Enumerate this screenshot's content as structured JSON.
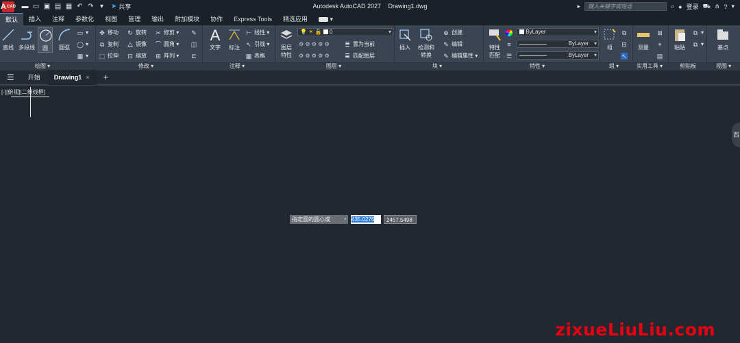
{
  "title_bar": {
    "logo_letter": "A",
    "logo_sub": "CAD",
    "share_label": "共享",
    "app_name": "Autodesk AutoCAD 2027",
    "file_name": "Drawing1.dwg",
    "search_placeholder": "键入关键字或短语",
    "login_label": "登录"
  },
  "ribbon_tabs": [
    "默认",
    "插入",
    "注释",
    "参数化",
    "视图",
    "管理",
    "输出",
    "附加模块",
    "协作",
    "Express Tools",
    "精选应用"
  ],
  "panels": {
    "draw": {
      "label": "绘图 ▾",
      "line": "直线",
      "polyline": "多段线",
      "circle": "圆",
      "arc": "圆弧"
    },
    "modify": {
      "label": "修改 ▾",
      "move": "移动",
      "rotate": "旋转",
      "trim": "修剪",
      "copy": "复制",
      "mirror": "镜像",
      "fillet": "圆角",
      "stretch": "拉伸",
      "scale": "缩放",
      "array": "阵列"
    },
    "annotation": {
      "label": "注释 ▾",
      "text": "文字",
      "dimension": "标注",
      "linear": "线性",
      "leader": "引线",
      "table": "表格"
    },
    "layers": {
      "label": "图层 ▾",
      "layer_props": "图层\n特性",
      "current_layer": "0",
      "set_current": "置为当前",
      "match_layer": "匹配图层"
    },
    "block": {
      "label": "块 ▾",
      "insert": "插入",
      "detect": "检测和\n转换",
      "create": "创建",
      "edit": "编辑",
      "edit_attr": "编辑属性"
    },
    "properties": {
      "label": "特性 ▾",
      "match": "特性\n匹配",
      "color": "ByLayer",
      "linetype": "ByLayer",
      "lineweight": "ByLayer"
    },
    "groups": {
      "label": "组 ▾",
      "group": "组"
    },
    "utilities": {
      "label": "实用工具 ▾",
      "measure": "测量"
    },
    "clipboard": {
      "label": "剪贴板",
      "paste": "粘贴"
    },
    "view": {
      "label": "视图 ▾",
      "base": "基点"
    }
  },
  "doc_tabs": {
    "start": "开始",
    "drawing": "Drawing1",
    "close": "×",
    "add": "+"
  },
  "canvas": {
    "viewport_label": "[-][俯视][二维线框]",
    "prompt": "指定圆的圆心或",
    "x_value": "435.0276",
    "y_value": "2457.5498",
    "viewcube_label": "西"
  },
  "watermark": "zixueLiuLiu.com"
}
